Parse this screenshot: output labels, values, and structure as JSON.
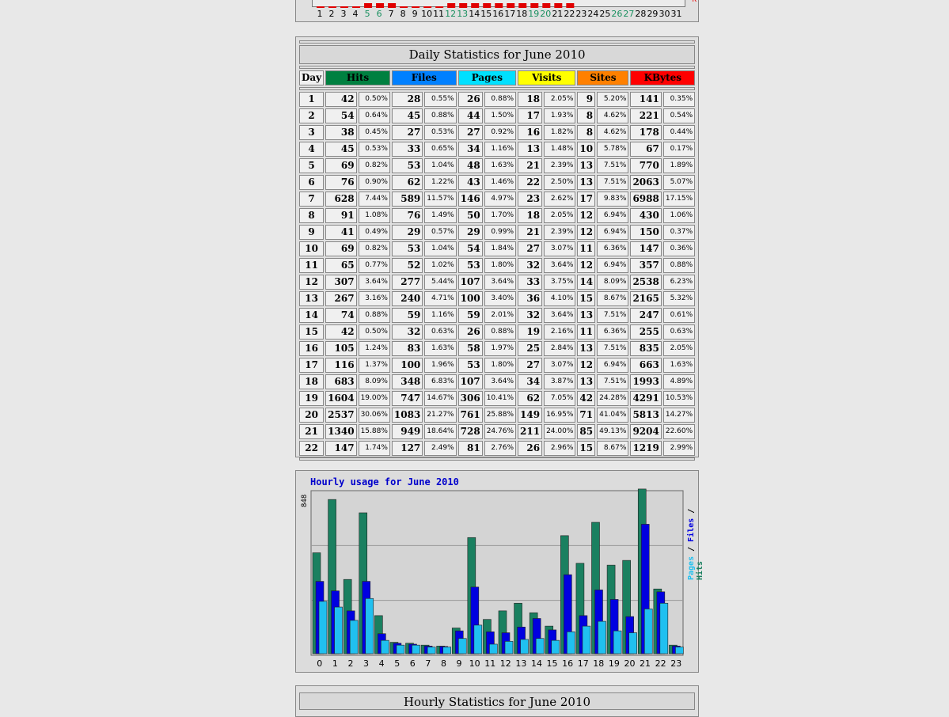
{
  "top_chart": {
    "days": [
      "1",
      "2",
      "3",
      "4",
      "5",
      "6",
      "7",
      "8",
      "9",
      "10",
      "11",
      "12",
      "13",
      "14",
      "15",
      "16",
      "17",
      "18",
      "19",
      "20",
      "21",
      "22",
      "23",
      "24",
      "25",
      "26",
      "27",
      "28",
      "29",
      "30",
      "31"
    ],
    "weekend_days": [
      5,
      6,
      12,
      13,
      19,
      20,
      26,
      27
    ],
    "kbytes_label": "K"
  },
  "daily": {
    "title": "Daily Statistics for June 2010",
    "headers": {
      "day": "Day",
      "hits": "Hits",
      "files": "Files",
      "pages": "Pages",
      "visits": "Visits",
      "sites": "Sites",
      "kbytes": "KBytes"
    },
    "header_colors": {
      "hits": "#008040",
      "files": "#0080ff",
      "pages": "#00e0ff",
      "visits": "#ffff00",
      "sites": "#ff8000",
      "kbytes": "#ff0000"
    },
    "rows": [
      [
        "1",
        "42",
        "0.50%",
        "28",
        "0.55%",
        "26",
        "0.88%",
        "18",
        "2.05%",
        "9",
        "5.20%",
        "141",
        "0.35%"
      ],
      [
        "2",
        "54",
        "0.64%",
        "45",
        "0.88%",
        "44",
        "1.50%",
        "17",
        "1.93%",
        "8",
        "4.62%",
        "221",
        "0.54%"
      ],
      [
        "3",
        "38",
        "0.45%",
        "27",
        "0.53%",
        "27",
        "0.92%",
        "16",
        "1.82%",
        "8",
        "4.62%",
        "178",
        "0.44%"
      ],
      [
        "4",
        "45",
        "0.53%",
        "33",
        "0.65%",
        "34",
        "1.16%",
        "13",
        "1.48%",
        "10",
        "5.78%",
        "67",
        "0.17%"
      ],
      [
        "5",
        "69",
        "0.82%",
        "53",
        "1.04%",
        "48",
        "1.63%",
        "21",
        "2.39%",
        "13",
        "7.51%",
        "770",
        "1.89%"
      ],
      [
        "6",
        "76",
        "0.90%",
        "62",
        "1.22%",
        "43",
        "1.46%",
        "22",
        "2.50%",
        "13",
        "7.51%",
        "2063",
        "5.07%"
      ],
      [
        "7",
        "628",
        "7.44%",
        "589",
        "11.57%",
        "146",
        "4.97%",
        "23",
        "2.62%",
        "17",
        "9.83%",
        "6988",
        "17.15%"
      ],
      [
        "8",
        "91",
        "1.08%",
        "76",
        "1.49%",
        "50",
        "1.70%",
        "18",
        "2.05%",
        "12",
        "6.94%",
        "430",
        "1.06%"
      ],
      [
        "9",
        "41",
        "0.49%",
        "29",
        "0.57%",
        "29",
        "0.99%",
        "21",
        "2.39%",
        "12",
        "6.94%",
        "150",
        "0.37%"
      ],
      [
        "10",
        "69",
        "0.82%",
        "53",
        "1.04%",
        "54",
        "1.84%",
        "27",
        "3.07%",
        "11",
        "6.36%",
        "147",
        "0.36%"
      ],
      [
        "11",
        "65",
        "0.77%",
        "52",
        "1.02%",
        "53",
        "1.80%",
        "32",
        "3.64%",
        "12",
        "6.94%",
        "357",
        "0.88%"
      ],
      [
        "12",
        "307",
        "3.64%",
        "277",
        "5.44%",
        "107",
        "3.64%",
        "33",
        "3.75%",
        "14",
        "8.09%",
        "2538",
        "6.23%"
      ],
      [
        "13",
        "267",
        "3.16%",
        "240",
        "4.71%",
        "100",
        "3.40%",
        "36",
        "4.10%",
        "15",
        "8.67%",
        "2165",
        "5.32%"
      ],
      [
        "14",
        "74",
        "0.88%",
        "59",
        "1.16%",
        "59",
        "2.01%",
        "32",
        "3.64%",
        "13",
        "7.51%",
        "247",
        "0.61%"
      ],
      [
        "15",
        "42",
        "0.50%",
        "32",
        "0.63%",
        "26",
        "0.88%",
        "19",
        "2.16%",
        "11",
        "6.36%",
        "255",
        "0.63%"
      ],
      [
        "16",
        "105",
        "1.24%",
        "83",
        "1.63%",
        "58",
        "1.97%",
        "25",
        "2.84%",
        "13",
        "7.51%",
        "835",
        "2.05%"
      ],
      [
        "17",
        "116",
        "1.37%",
        "100",
        "1.96%",
        "53",
        "1.80%",
        "27",
        "3.07%",
        "12",
        "6.94%",
        "663",
        "1.63%"
      ],
      [
        "18",
        "683",
        "8.09%",
        "348",
        "6.83%",
        "107",
        "3.64%",
        "34",
        "3.87%",
        "13",
        "7.51%",
        "1993",
        "4.89%"
      ],
      [
        "19",
        "1604",
        "19.00%",
        "747",
        "14.67%",
        "306",
        "10.41%",
        "62",
        "7.05%",
        "42",
        "24.28%",
        "4291",
        "10.53%"
      ],
      [
        "20",
        "2537",
        "30.06%",
        "1083",
        "21.27%",
        "761",
        "25.88%",
        "149",
        "16.95%",
        "71",
        "41.04%",
        "5813",
        "14.27%"
      ],
      [
        "21",
        "1340",
        "15.88%",
        "949",
        "18.64%",
        "728",
        "24.76%",
        "211",
        "24.00%",
        "85",
        "49.13%",
        "9204",
        "22.60%"
      ],
      [
        "22",
        "147",
        "1.74%",
        "127",
        "2.49%",
        "81",
        "2.76%",
        "26",
        "2.96%",
        "15",
        "8.67%",
        "1219",
        "2.99%"
      ]
    ]
  },
  "hourly_chart": {
    "title": "Hourly usage for June 2010",
    "max_label": "848",
    "legend": {
      "pages": "Pages",
      "sep1": " / ",
      "files": "Files",
      "sep2": " / ",
      "hits": "Hits"
    },
    "colors": {
      "hits": "#1a8060",
      "files": "#0000e0",
      "pages": "#20c0f0"
    }
  },
  "chart_data": {
    "type": "bar",
    "title": "Hourly usage for June 2010",
    "categories": [
      "0",
      "1",
      "2",
      "3",
      "4",
      "5",
      "6",
      "7",
      "8",
      "9",
      "10",
      "11",
      "12",
      "13",
      "14",
      "15",
      "16",
      "17",
      "18",
      "19",
      "20",
      "21",
      "22",
      "23"
    ],
    "ylim": [
      0,
      848
    ],
    "series": [
      {
        "name": "Hits",
        "values": [
          530,
          810,
          390,
          740,
          200,
          60,
          55,
          45,
          40,
          135,
          610,
          180,
          225,
          265,
          215,
          145,
          620,
          475,
          690,
          465,
          490,
          865,
          340,
          45
        ]
      },
      {
        "name": "Files",
        "values": [
          380,
          330,
          225,
          380,
          105,
          55,
          50,
          40,
          38,
          120,
          350,
          115,
          110,
          140,
          185,
          125,
          415,
          200,
          335,
          285,
          195,
          680,
          325,
          40
        ]
      },
      {
        "name": "Pages",
        "values": [
          275,
          245,
          175,
          290,
          70,
          45,
          45,
          35,
          35,
          80,
          150,
          50,
          65,
          75,
          80,
          70,
          115,
          145,
          170,
          120,
          110,
          235,
          265,
          35
        ]
      }
    ]
  },
  "hourly_stats": {
    "title": "Hourly Statistics for June 2010"
  }
}
